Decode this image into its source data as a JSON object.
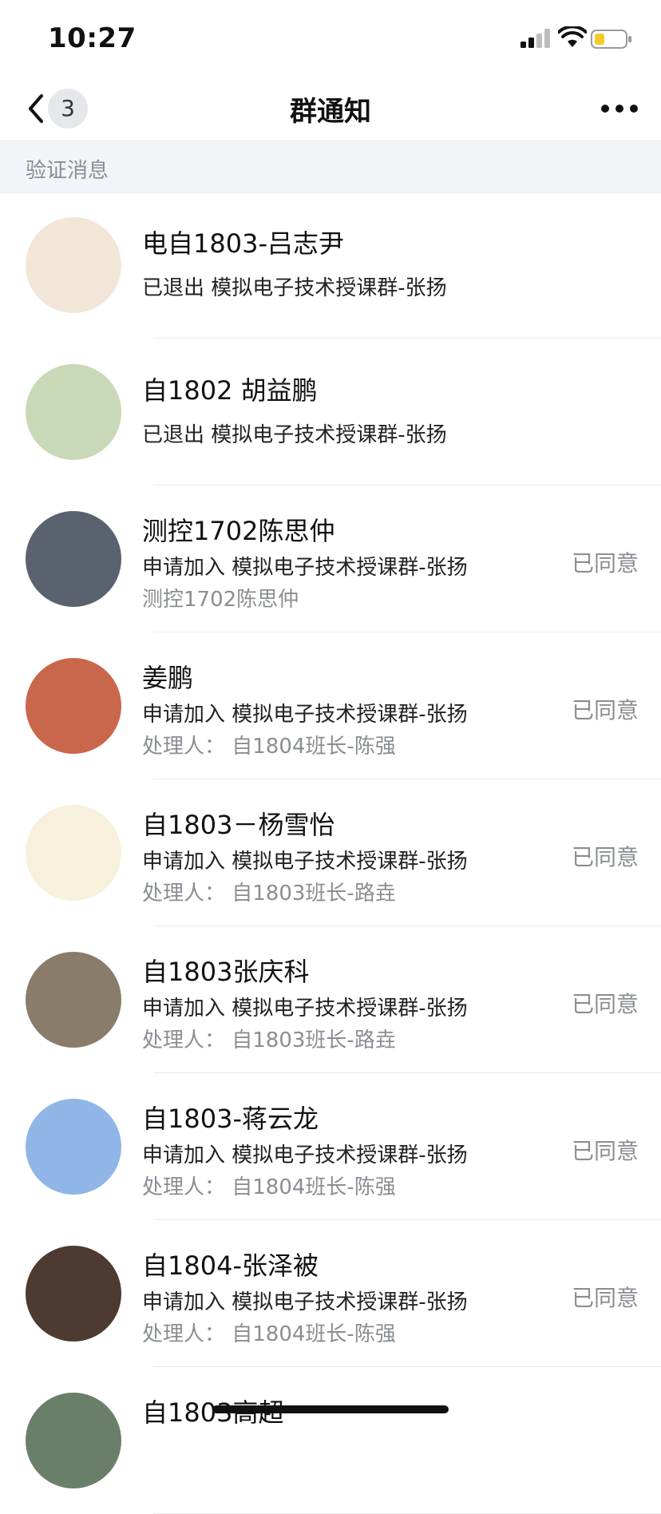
{
  "status_bar": {
    "time": "10:27"
  },
  "nav": {
    "back_count": "3",
    "title": "群通知"
  },
  "section": {
    "label": "验证消息"
  },
  "notifications": [
    {
      "name": "电自1803-吕志尹",
      "action": "已退出 模拟电子技术授课群-张扬",
      "avatar_color": "#f2e6d8",
      "type": "left"
    },
    {
      "name": "自1802 胡益鹏",
      "action": "已退出 模拟电子技术授课群-张扬",
      "avatar_color": "#c9d8b6",
      "type": "left"
    },
    {
      "name": "测控1702陈思仲",
      "action": "申请加入 模拟电子技术授课群-张扬",
      "detail": "测控1702陈思仲",
      "status": "已同意",
      "avatar_color": "#5a6270"
    },
    {
      "name": "姜鹏",
      "action": "申请加入 模拟电子技术授课群-张扬",
      "detail": "处理人： 自1804班长-陈强",
      "status": "已同意",
      "avatar_color": "#c9674c"
    },
    {
      "name": "自1803－杨雪怡",
      "action": "申请加入 模拟电子技术授课群-张扬",
      "detail": "处理人： 自1803班长-路垚",
      "status": "已同意",
      "avatar_color": "#f6f0dc"
    },
    {
      "name": "自1803张庆科",
      "action": "申请加入 模拟电子技术授课群-张扬",
      "detail": "处理人： 自1803班长-路垚",
      "status": "已同意",
      "avatar_color": "#8a7c6b"
    },
    {
      "name": "自1803-蒋云龙",
      "action": "申请加入 模拟电子技术授课群-张扬",
      "detail": "处理人： 自1804班长-陈强",
      "status": "已同意",
      "avatar_color": "#8fb6e6"
    },
    {
      "name": "自1804-张泽被",
      "action": "申请加入 模拟电子技术授课群-张扬",
      "detail": "处理人： 自1804班长-陈强",
      "status": "已同意",
      "avatar_color": "#4d3a30"
    },
    {
      "name": "自1803高超",
      "action": "",
      "avatar_color": "#6a7f6a"
    }
  ]
}
